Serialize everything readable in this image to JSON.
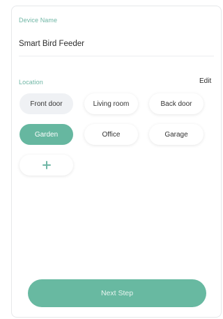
{
  "device": {
    "name_label": "Device Name",
    "name_value": "Smart Bird Feeder"
  },
  "location": {
    "label": "Location",
    "edit_label": "Edit",
    "options": [
      {
        "label": "Front door",
        "selected": false
      },
      {
        "label": "Living room",
        "selected": false
      },
      {
        "label": "Back door",
        "selected": false
      },
      {
        "label": "Garden",
        "selected": true
      },
      {
        "label": "Office",
        "selected": false
      },
      {
        "label": "Garage",
        "selected": false
      }
    ],
    "add_icon": "plus-icon"
  },
  "footer": {
    "next_label": "Next Step"
  },
  "colors": {
    "accent": "#66b7a0",
    "label_green": "#6fb6a5",
    "chip_muted": "#eff1f4"
  }
}
